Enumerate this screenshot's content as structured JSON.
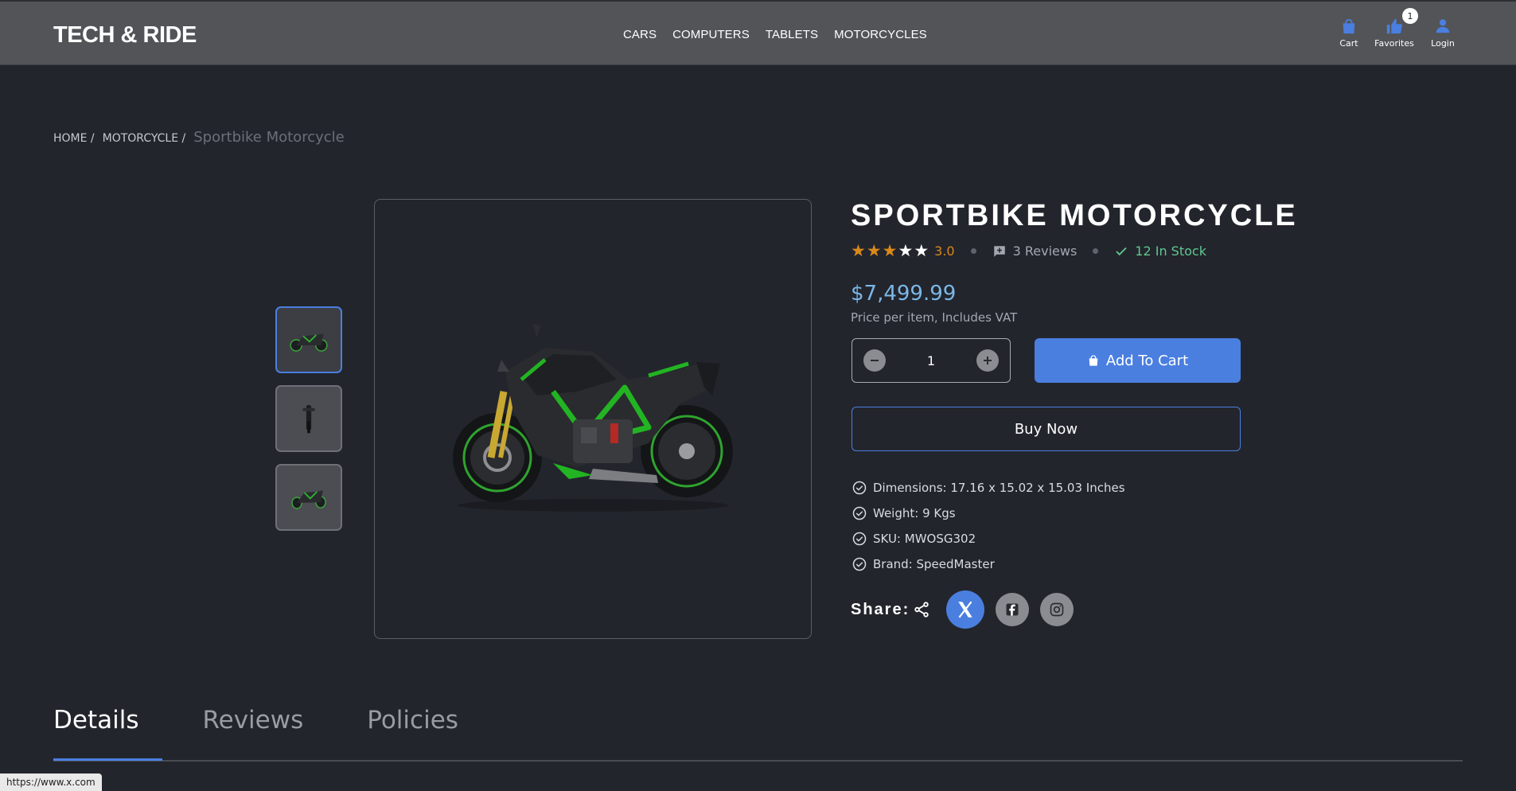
{
  "header": {
    "logo": "TECH & RIDE",
    "nav": [
      "CARS",
      "COMPUTERS",
      "TABLETS",
      "MOTORCYCLES"
    ],
    "cart_label": "Cart",
    "favorites_label": "Favorites",
    "favorites_count": "1",
    "login_label": "Login"
  },
  "breadcrumb": {
    "home": "HOME /",
    "category": "MOTORCYCLE /",
    "current": "Sportbike Motorcycle"
  },
  "product": {
    "title": "SPORTBIKE MOTORCYCLE",
    "rating": 3.0,
    "rating_text": "3.0",
    "reviews_text": "3 Reviews",
    "stock_text": "12 In Stock",
    "price": "$7,499.99",
    "price_note": "Price per item, Includes VAT",
    "quantity": "1",
    "add_to_cart": "Add To Cart",
    "buy_now": "Buy Now",
    "specs": [
      "Dimensions: 17.16 x 15.02 x 15.03 Inches",
      "Weight: 9 Kgs",
      "SKU: MWOSG302",
      "Brand: SpeedMaster"
    ],
    "share_label": "Share:"
  },
  "icons": {
    "cart": "cart-icon",
    "favorites": "thumbs-up-icon",
    "login": "user-icon",
    "reviews": "comment-plus-icon",
    "stock": "check-icon",
    "spec": "check-circle-icon",
    "share": "share-icon",
    "social": [
      "x-icon",
      "facebook-icon",
      "instagram-icon"
    ]
  },
  "tabs": [
    "Details",
    "Reviews",
    "Policies"
  ],
  "active_tab": "Details",
  "status_url": "https://www.x.com",
  "colors": {
    "accent": "#4a7fe0",
    "price": "#7ab8e8",
    "star": "#d9891a",
    "stock": "#5fc78e",
    "background": "#23252d",
    "header": "#525458"
  }
}
